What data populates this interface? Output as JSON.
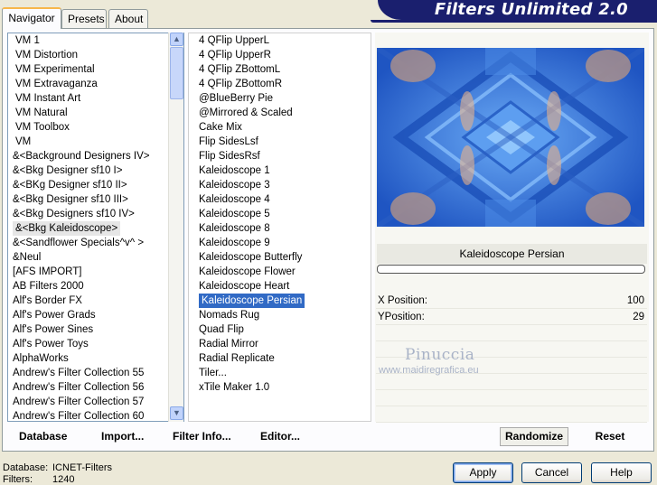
{
  "tabs": [
    "Navigator",
    "Presets",
    "About"
  ],
  "banner_title": "Filters Unlimited 2.0",
  "categories": [
    "VM 1",
    "VM Distortion",
    "VM Experimental",
    "VM Extravaganza",
    "VM Instant Art",
    "VM Natural",
    "VM Toolbox",
    "VM",
    "&<Background Designers IV>",
    "&<Bkg Designer sf10 I>",
    "&<BKg Designer sf10 II>",
    "&<Bkg Designer sf10 III>",
    "&<Bkg Designers sf10 IV>",
    "&<Bkg Kaleidoscope>",
    "&<Sandflower Specials^v^ >",
    "&Neul",
    "[AFS IMPORT]",
    "AB Filters 2000",
    "Alf's Border FX",
    "Alf's Power Grads",
    "Alf's Power Sines",
    "Alf's Power Toys",
    "AlphaWorks",
    "Andrew's Filter Collection 55",
    "Andrew's Filter Collection 56",
    "Andrew's Filter Collection 57",
    "Andrew's Filter Collection 60"
  ],
  "selected_category": "&<Bkg Kaleidoscope>",
  "filters": [
    "4 QFlip UpperL",
    "4 QFlip UpperR",
    "4 QFlip ZBottomL",
    "4 QFlip ZBottomR",
    "@BlueBerry Pie",
    "@Mirrored & Scaled",
    "Cake Mix",
    "Flip SidesLsf",
    "Flip SidesRsf",
    "Kaleidoscope 1",
    "Kaleidoscope 3",
    "Kaleidoscope 4",
    "Kaleidoscope 5",
    "Kaleidoscope 8",
    "Kaleidoscope 9",
    "Kaleidoscope Butterfly",
    "Kaleidoscope Flower",
    "Kaleidoscope Heart",
    "Kaleidoscope Persian",
    "Nomads Rug",
    "Quad Flip",
    "Radial Mirror",
    "Radial Replicate",
    "Tiler...",
    "xTile Maker 1.0"
  ],
  "selected_filter": "Kaleidoscope Persian",
  "filter_name_display": "Kaleidoscope Persian",
  "params": [
    {
      "label": "X Position:",
      "value": "100"
    },
    {
      "label": "YPosition:",
      "value": "29"
    }
  ],
  "progress": 0,
  "watermark": {
    "name": "Pinuccia",
    "url": "www.maidiregrafica.eu"
  },
  "toolbar": {
    "database": "Database",
    "import": "Import...",
    "filter_info": "Filter Info...",
    "editor": "Editor...",
    "randomize": "Randomize",
    "reset": "Reset"
  },
  "footer": {
    "database_label": "Database:",
    "database_value": "ICNET-Filters",
    "filters_label": "Filters:",
    "filters_value": "1240"
  },
  "buttons": {
    "apply": "Apply",
    "cancel": "Cancel",
    "help": "Help"
  },
  "colors": {
    "selection": "#316ac5",
    "banner": "#1a1f6e",
    "tab_highlight": "#f7b74b",
    "preview_blue": "#3a7be0"
  }
}
